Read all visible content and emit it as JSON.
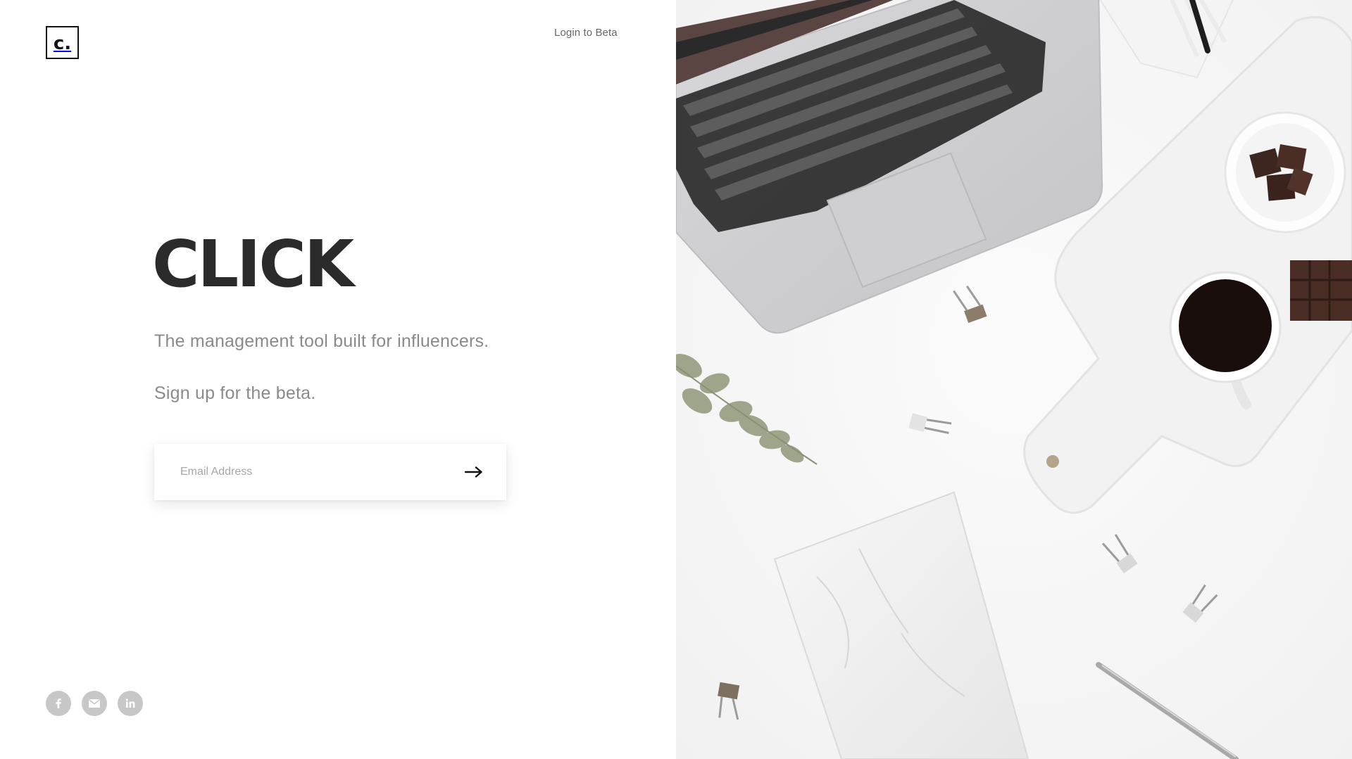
{
  "brand": {
    "logo_text": "c."
  },
  "header": {
    "login_label": "Login to Beta"
  },
  "hero": {
    "title": "CLICK",
    "tagline": "The management tool built for influencers.",
    "signup_text": "Sign up for the beta."
  },
  "signup_form": {
    "email_placeholder": "Email Address",
    "email_value": "",
    "submit_icon": "arrow-right-icon"
  },
  "social": [
    {
      "icon": "facebook-icon"
    },
    {
      "icon": "email-icon"
    },
    {
      "icon": "linkedin-icon"
    }
  ],
  "colors": {
    "title": "#2b2b2b",
    "body_text": "#8a8a8a",
    "social_bg": "#c7c7c7",
    "background": "#ffffff"
  }
}
